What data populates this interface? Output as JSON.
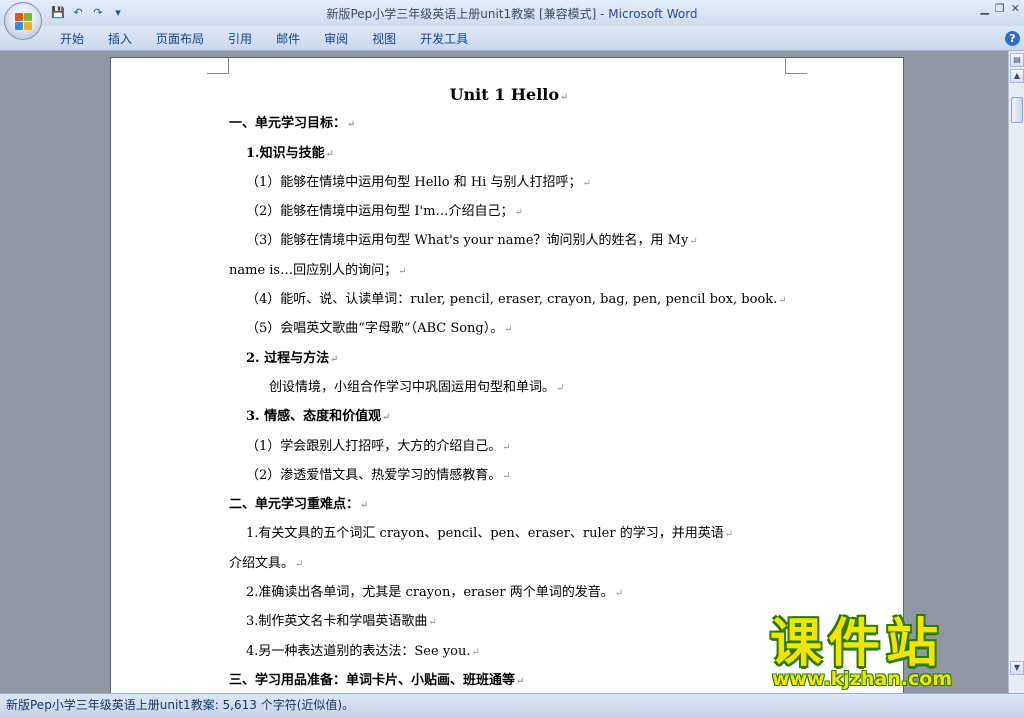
{
  "window": {
    "title_doc": "新版Pep小学三年级英语上册unit1教案 [兼容模式]",
    "title_sep": " - ",
    "title_app": "Microsoft Word"
  },
  "ribbon": {
    "tabs": [
      "开始",
      "插入",
      "页面布局",
      "引用",
      "邮件",
      "审阅",
      "视图",
      "开发工具"
    ]
  },
  "document": {
    "lines": [
      {
        "text": "Unit 1    Hello",
        "style": "h1",
        "indent": 0
      },
      {
        "text": "一、单元学习目标：",
        "style": "b",
        "indent": 0
      },
      {
        "text": "1.知识与技能",
        "style": "b",
        "indent": 17
      },
      {
        "text": "（1）能够在情境中运用句型 Hello 和 Hi 与别人打招呼；",
        "style": "",
        "indent": 17
      },
      {
        "text": "（2）能够在情境中运用句型 I'm…介绍自己；",
        "style": "",
        "indent": 17
      },
      {
        "text": "（3）能够在情境中运用句型  What's    your    name？询问别人的姓名，用  My",
        "style": "",
        "indent": 17
      },
      {
        "text": "name    is…回应别人的询问；",
        "style": "",
        "indent": 0
      },
      {
        "text": "（4）能听、说、认读单词：ruler, pencil, eraser, crayon, bag, pen, pencil box, book.",
        "style": "",
        "indent": 17
      },
      {
        "text": "（5）会唱英文歌曲“字母歌”（ABC Song）。",
        "style": "",
        "indent": 17
      },
      {
        "text": "2. 过程与方法",
        "style": "b",
        "indent": 17
      },
      {
        "text": "创设情境，小组合作学习中巩固运用句型和单词。",
        "style": "",
        "indent": 40
      },
      {
        "text": "3. 情感、态度和价值观",
        "style": "b",
        "indent": 17
      },
      {
        "text": "（1）学会跟别人打招呼，大方的介绍自己。",
        "style": "",
        "indent": 17
      },
      {
        "text": "（2）渗透爱惜文具、热爱学习的情感教育。",
        "style": "",
        "indent": 17
      },
      {
        "text": "二、单元学习重难点：",
        "style": "b",
        "indent": 0
      },
      {
        "text": "1.有关文具的五个词汇  crayon、pencil、pen、eraser、ruler  的学习，并用英语",
        "style": "",
        "indent": 17
      },
      {
        "text": "介绍文具。",
        "style": "",
        "indent": 0
      },
      {
        "text": "2.准确读出各单词，尤其是 crayon，eraser  两个单词的发音。",
        "style": "",
        "indent": 17
      },
      {
        "text": "3.制作英文名卡和学唱英语歌曲",
        "style": "",
        "indent": 17
      },
      {
        "text": "4.另一种表达道别的表达法：See you.",
        "style": "",
        "indent": 17
      },
      {
        "text": "三、学习用品准备：单词卡片、小贴画、班班通等",
        "style": "b",
        "indent": 0
      }
    ]
  },
  "status": {
    "text": "新版Pep小学三年级英语上册unit1教案: 5,613 个字符(近似值)。"
  },
  "watermark": {
    "main": "课件站",
    "url": "www.kjzhan.com"
  },
  "colors": {
    "ribbon_tab_text": "#15428b",
    "page_bg": "#ffffff",
    "workspace_bg": "#8f97a4"
  }
}
